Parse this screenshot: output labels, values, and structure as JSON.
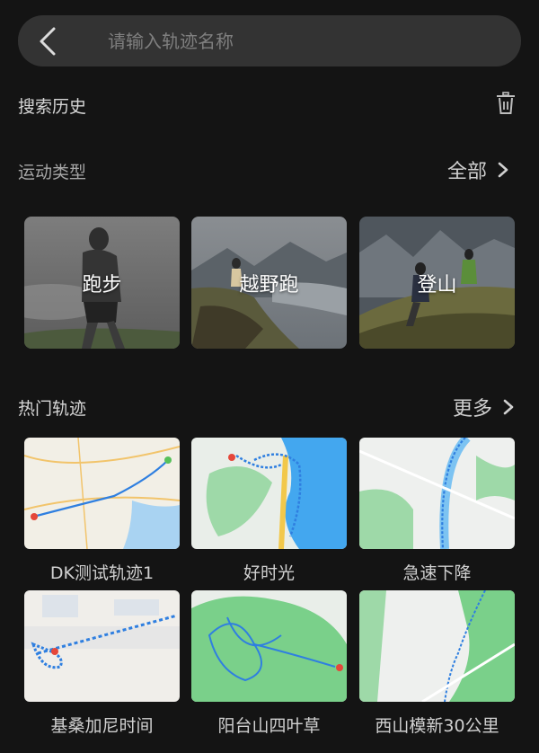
{
  "search": {
    "placeholder": "请输入轨迹名称",
    "value": ""
  },
  "history": {
    "title": "搜索历史"
  },
  "sports": {
    "title": "运动类型",
    "all_label": "全部",
    "items": [
      {
        "label": "跑步"
      },
      {
        "label": "越野跑"
      },
      {
        "label": "登山"
      }
    ]
  },
  "hot": {
    "title": "热门轨迹",
    "more_label": "更多",
    "tracks": [
      {
        "name": "DK测试轨迹1"
      },
      {
        "name": "好时光"
      },
      {
        "name": "急速下降"
      },
      {
        "name": "基桑加尼时间"
      },
      {
        "name": "阳台山四叶草"
      },
      {
        "name": "西山模新30公里"
      }
    ]
  },
  "colors": {
    "background": "#141414",
    "search_bg": "#333333",
    "track_line": "#2f7fe0",
    "map_water": "#43a7ef",
    "map_green": "#6fd17e"
  },
  "icons": {
    "back": "chevron-left-icon",
    "trash": "trash-icon",
    "more": "chevron-right-icon"
  }
}
